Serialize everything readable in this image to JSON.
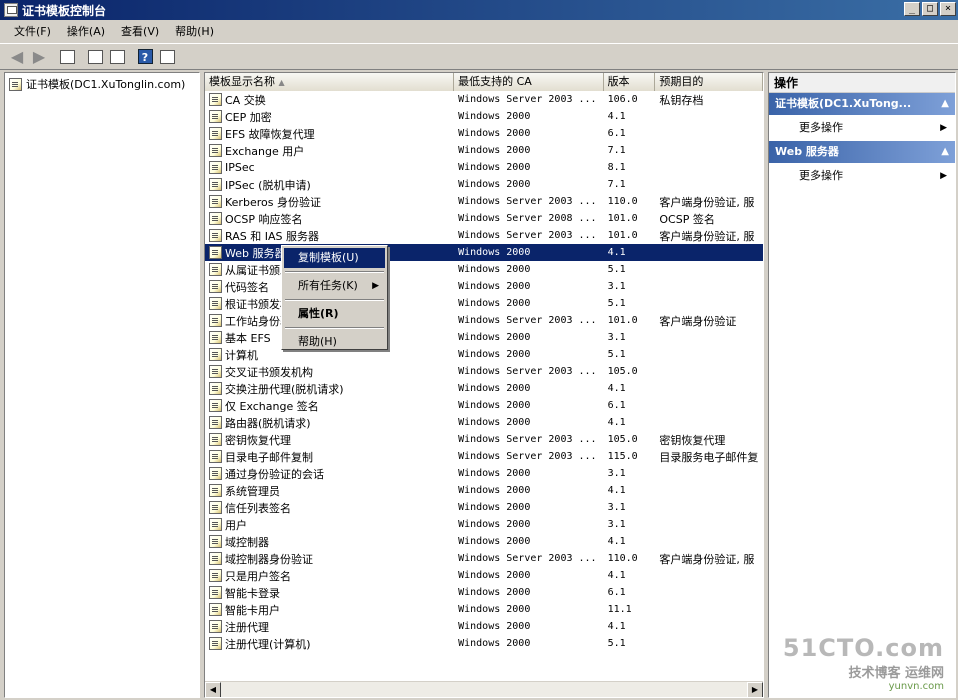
{
  "window": {
    "title": "证书模板控制台",
    "btn_min": "_",
    "btn_max": "□",
    "btn_close": "×"
  },
  "menu": [
    "文件(F)",
    "操作(A)",
    "查看(V)",
    "帮助(H)"
  ],
  "tree": {
    "root": "证书模板(DC1.XuTonglin.com)"
  },
  "columns": [
    "模板显示名称",
    "最低支持的 CA",
    "版本",
    "预期目的"
  ],
  "rows": [
    [
      "CA 交换",
      "Windows Server 2003 ...",
      "106.0",
      "私钥存档"
    ],
    [
      "CEP 加密",
      "Windows 2000",
      "4.1",
      ""
    ],
    [
      "EFS 故障恢复代理",
      "Windows 2000",
      "6.1",
      ""
    ],
    [
      "Exchange 用户",
      "Windows 2000",
      "7.1",
      ""
    ],
    [
      "IPSec",
      "Windows 2000",
      "8.1",
      ""
    ],
    [
      "IPSec (脱机申请)",
      "Windows 2000",
      "7.1",
      ""
    ],
    [
      "Kerberos 身份验证",
      "Windows Server 2003 ...",
      "110.0",
      "客户端身份验证, 服"
    ],
    [
      "OCSP 响应签名",
      "Windows Server 2008 ...",
      "101.0",
      "OCSP 签名"
    ],
    [
      "RAS 和 IAS 服务器",
      "Windows Server 2003 ...",
      "101.0",
      "客户端身份验证, 服"
    ],
    [
      "Web 服务器",
      "Windows 2000",
      "4.1",
      ""
    ],
    [
      "从属证书颁发机构",
      "Windows 2000",
      "5.1",
      ""
    ],
    [
      "代码签名",
      "Windows 2000",
      "3.1",
      ""
    ],
    [
      "根证书颁发机构",
      "Windows 2000",
      "5.1",
      ""
    ],
    [
      "工作站身份验证",
      "Windows Server 2003 ...",
      "101.0",
      "客户端身份验证"
    ],
    [
      "基本 EFS",
      "Windows 2000",
      "3.1",
      ""
    ],
    [
      "计算机",
      "Windows 2000",
      "5.1",
      ""
    ],
    [
      "交叉证书颁发机构",
      "Windows Server 2003 ...",
      "105.0",
      ""
    ],
    [
      "交换注册代理(脱机请求)",
      "Windows 2000",
      "4.1",
      ""
    ],
    [
      "仅 Exchange 签名",
      "Windows 2000",
      "6.1",
      ""
    ],
    [
      "路由器(脱机请求)",
      "Windows 2000",
      "4.1",
      ""
    ],
    [
      "密钥恢复代理",
      "Windows Server 2003 ...",
      "105.0",
      "密钥恢复代理"
    ],
    [
      "目录电子邮件复制",
      "Windows Server 2003 ...",
      "115.0",
      "目录服务电子邮件复"
    ],
    [
      "通过身份验证的会话",
      "Windows 2000",
      "3.1",
      ""
    ],
    [
      "系统管理员",
      "Windows 2000",
      "4.1",
      ""
    ],
    [
      "信任列表签名",
      "Windows 2000",
      "3.1",
      ""
    ],
    [
      "用户",
      "Windows 2000",
      "3.1",
      ""
    ],
    [
      "域控制器",
      "Windows 2000",
      "4.1",
      ""
    ],
    [
      "域控制器身份验证",
      "Windows Server 2003 ...",
      "110.0",
      "客户端身份验证, 服"
    ],
    [
      "只是用户签名",
      "Windows 2000",
      "4.1",
      ""
    ],
    [
      "智能卡登录",
      "Windows 2000",
      "6.1",
      ""
    ],
    [
      "智能卡用户",
      "Windows 2000",
      "11.1",
      ""
    ],
    [
      "注册代理",
      "Windows 2000",
      "4.1",
      ""
    ],
    [
      "注册代理(计算机)",
      "Windows 2000",
      "5.1",
      ""
    ]
  ],
  "selected_row": 9,
  "context_menu": {
    "duplicate": "复制模板(U)",
    "all_tasks": "所有任务(K)",
    "properties": "属性(R)",
    "help": "帮助(H)"
  },
  "actions": {
    "header": "操作",
    "group1": "证书模板(DC1.XuTong...",
    "group1_item": "更多操作",
    "group2": "Web 服务器",
    "group2_item": "更多操作"
  },
  "watermark": {
    "line1": "51CTO.com",
    "line2": "技术博客 运维网",
    "line3": "yunvn.com"
  },
  "colors": {
    "selection": "#0a246a",
    "titlebar": "#0a246a",
    "action_group": "#3a63a8"
  }
}
